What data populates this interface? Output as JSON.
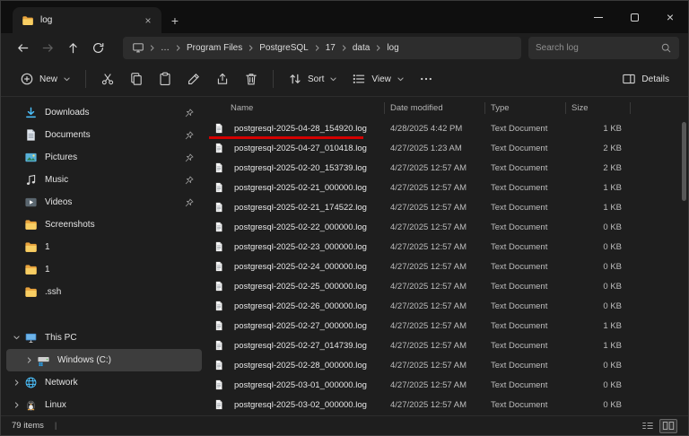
{
  "titlebar": {
    "tab": {
      "title": "log",
      "close": "×"
    },
    "newtab": "+",
    "controls": {
      "close": "×"
    }
  },
  "navbar": {
    "breadcrumb": {
      "root_icon": "monitor-icon",
      "ellipsis": "…",
      "items": [
        "Program Files",
        "PostgreSQL",
        "17",
        "data",
        "log"
      ]
    },
    "search": {
      "placeholder": "Search log"
    }
  },
  "toolbar": {
    "new_label": "New",
    "sort_label": "Sort",
    "view_label": "View",
    "details_label": "Details"
  },
  "sidebar": {
    "items": [
      {
        "label": "Downloads",
        "icon": "downloads-icon",
        "pinned": true
      },
      {
        "label": "Documents",
        "icon": "documents-icon",
        "pinned": true
      },
      {
        "label": "Pictures",
        "icon": "pictures-icon",
        "pinned": true
      },
      {
        "label": "Music",
        "icon": "music-icon",
        "pinned": true
      },
      {
        "label": "Videos",
        "icon": "videos-icon",
        "pinned": true
      },
      {
        "label": "Screenshots",
        "icon": "folder-icon"
      },
      {
        "label": "1",
        "icon": "folder-icon"
      },
      {
        "label": "1",
        "icon": "folder-icon"
      },
      {
        "label": ".ssh",
        "icon": "folder-icon"
      },
      {
        "label": "This PC",
        "icon": "thispc-icon",
        "chevron": "down",
        "gap_before": true
      },
      {
        "label": "Windows (C:)",
        "icon": "drive-icon",
        "chevron": "right",
        "indent": true,
        "selected": true
      },
      {
        "label": "Network",
        "icon": "network-icon",
        "chevron": "right"
      },
      {
        "label": "Linux",
        "icon": "linux-icon",
        "chevron": "right"
      }
    ]
  },
  "files": {
    "columns": [
      "Name",
      "Date modified",
      "Type",
      "Size"
    ],
    "rows": [
      {
        "name": "postgresql-2025-04-28_154920.log",
        "date": "4/28/2025 4:42 PM",
        "type": "Text Document",
        "size": "1 KB",
        "annotated": true
      },
      {
        "name": "postgresql-2025-04-27_010418.log",
        "date": "4/27/2025 1:23 AM",
        "type": "Text Document",
        "size": "2 KB"
      },
      {
        "name": "postgresql-2025-02-20_153739.log",
        "date": "4/27/2025 12:57 AM",
        "type": "Text Document",
        "size": "2 KB"
      },
      {
        "name": "postgresql-2025-02-21_000000.log",
        "date": "4/27/2025 12:57 AM",
        "type": "Text Document",
        "size": "1 KB"
      },
      {
        "name": "postgresql-2025-02-21_174522.log",
        "date": "4/27/2025 12:57 AM",
        "type": "Text Document",
        "size": "1 KB"
      },
      {
        "name": "postgresql-2025-02-22_000000.log",
        "date": "4/27/2025 12:57 AM",
        "type": "Text Document",
        "size": "0 KB"
      },
      {
        "name": "postgresql-2025-02-23_000000.log",
        "date": "4/27/2025 12:57 AM",
        "type": "Text Document",
        "size": "0 KB"
      },
      {
        "name": "postgresql-2025-02-24_000000.log",
        "date": "4/27/2025 12:57 AM",
        "type": "Text Document",
        "size": "0 KB"
      },
      {
        "name": "postgresql-2025-02-25_000000.log",
        "date": "4/27/2025 12:57 AM",
        "type": "Text Document",
        "size": "0 KB"
      },
      {
        "name": "postgresql-2025-02-26_000000.log",
        "date": "4/27/2025 12:57 AM",
        "type": "Text Document",
        "size": "0 KB"
      },
      {
        "name": "postgresql-2025-02-27_000000.log",
        "date": "4/27/2025 12:57 AM",
        "type": "Text Document",
        "size": "1 KB"
      },
      {
        "name": "postgresql-2025-02-27_014739.log",
        "date": "4/27/2025 12:57 AM",
        "type": "Text Document",
        "size": "1 KB"
      },
      {
        "name": "postgresql-2025-02-28_000000.log",
        "date": "4/27/2025 12:57 AM",
        "type": "Text Document",
        "size": "0 KB"
      },
      {
        "name": "postgresql-2025-03-01_000000.log",
        "date": "4/27/2025 12:57 AM",
        "type": "Text Document",
        "size": "0 KB"
      },
      {
        "name": "postgresql-2025-03-02_000000.log",
        "date": "4/27/2025 12:57 AM",
        "type": "Text Document",
        "size": "0 KB"
      }
    ]
  },
  "statusbar": {
    "count": "79 items",
    "separator": "|"
  },
  "annotation": {
    "color": "#d40000"
  },
  "colors": {
    "accent": "#4cc2ff",
    "folder": "#f8ce63"
  }
}
